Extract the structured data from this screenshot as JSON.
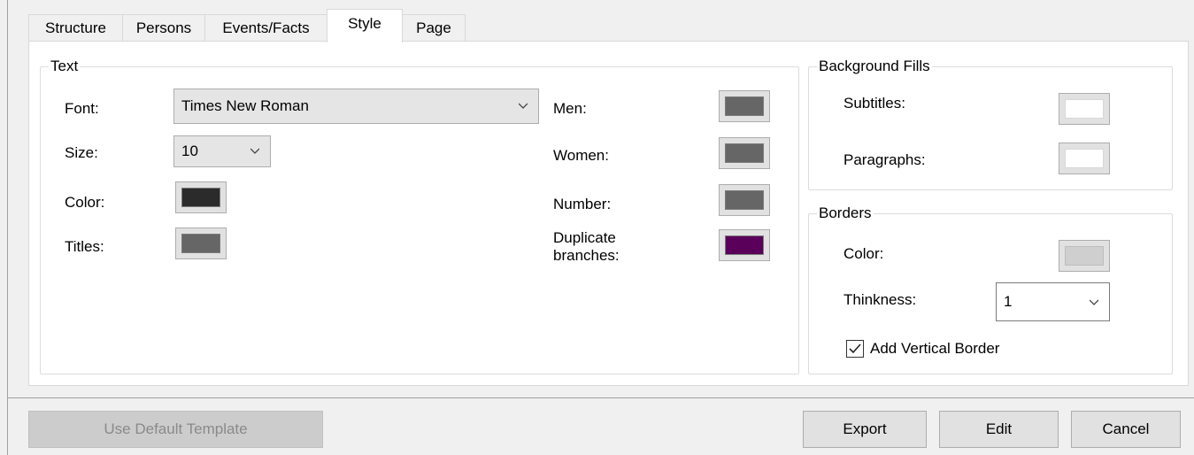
{
  "tabs": [
    {
      "label": "Structure"
    },
    {
      "label": "Persons"
    },
    {
      "label": "Events/Facts"
    },
    {
      "label": "Style"
    },
    {
      "label": "Page"
    }
  ],
  "active_tab": "Style",
  "text_group": {
    "title": "Text",
    "font_label": "Font:",
    "font_value": "Times New Roman",
    "size_label": "Size:",
    "size_value": "10",
    "color_label": "Color:",
    "titles_label": "Titles:",
    "men_label": "Men:",
    "women_label": "Women:",
    "number_label": "Number:",
    "duplicate_label_line1": "Duplicate",
    "duplicate_label_line2": "branches:"
  },
  "background_group": {
    "title": "Background Fills",
    "subtitles_label": "Subtitles:",
    "paragraphs_label": "Paragraphs:"
  },
  "borders_group": {
    "title": "Borders",
    "color_label": "Color:",
    "thickness_label": "Thinkness:",
    "thickness_value": "1",
    "vertical_border_label": "Add Vertical Border",
    "vertical_border_checked": true
  },
  "colors": {
    "text_color": "#2b2b2b",
    "titles_color": "#666666",
    "men_color": "#666666",
    "women_color": "#666666",
    "number_color": "#666666",
    "duplicate_color": "#5a005a",
    "subtitles_fill": "#ffffff",
    "paragraphs_fill": "#ffffff",
    "border_color": "#cfcfcf"
  },
  "buttons": {
    "default_template": "Use Default Template",
    "export": "Export",
    "edit": "Edit",
    "cancel": "Cancel"
  }
}
